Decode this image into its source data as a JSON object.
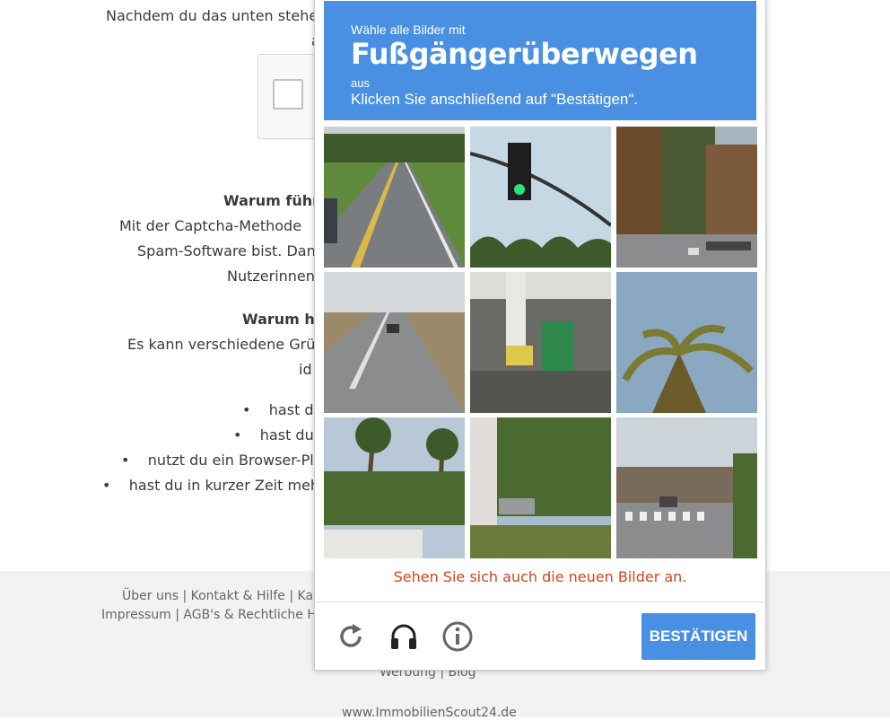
{
  "page": {
    "intro_line1": "Nachdem du das unten stehe",
    "intro_line2": "a",
    "why_heading": "Warum führe",
    "why_p1": "Mit der Captcha-Methode",
    "why_p2": "Spam-Software bist. Dan",
    "why_p3": "Nutzerinnen",
    "why2_heading": "Warum ha",
    "why2_p1": "Es kann verschiedene Grü",
    "why2_p2": "id",
    "bullets": [
      "hast du",
      "hast du",
      "nutzt du ein Browser-Plu",
      "hast du in kurzer Zeit mehr"
    ]
  },
  "footer": {
    "line1": "Über uns | Kontakt & Hilfe | Karr",
    "line2": "Impressum | AGB's & Rechtliche Hi",
    "line3": "Werbung | Blog",
    "line4": "www.ImmobilienScout24.de"
  },
  "captcha": {
    "header_small": "Wähle alle Bilder mit",
    "header_target": "Fußgängerüberwegen",
    "header_aus": "aus",
    "header_instruction": "Klicken Sie anschließend auf \"Bestätigen\".",
    "new_images_text": "Sehen Sie sich auch die neuen Bilder an.",
    "confirm_label": "BESTÄTIGEN",
    "tiles": [
      "road-1",
      "traffic-light",
      "trees-street",
      "road-2",
      "gas-station",
      "palm-tree",
      "palm-building",
      "bushes-car",
      "crosswalk"
    ],
    "icons": [
      "reload-icon",
      "audio-icon",
      "info-icon"
    ],
    "accent_color": "#4a90e2",
    "alert_color": "#d0451b"
  }
}
